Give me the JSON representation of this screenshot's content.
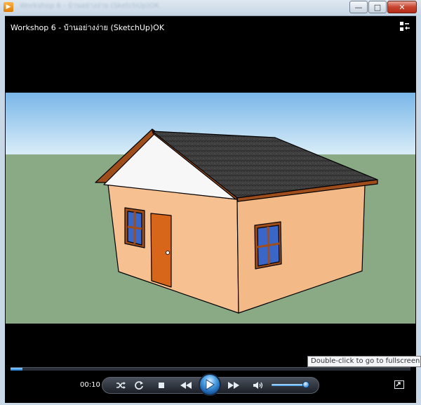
{
  "window": {
    "video_title": "Workshop 6 - บ้านอย่างง่าย (SketchUp)OK",
    "ghost_title": "Workshop 6 - บ้านอย่างง่าย (SketchUp)OK - Windows Media Player",
    "caption": {
      "minimize": "—",
      "maximize": "□",
      "close": "✕"
    }
  },
  "player": {
    "elapsed_time": "00:10",
    "seek_progress": 0.03,
    "volume_level": 0.9,
    "tooltip": "Double-click to go to fullscreen, ctrl+"
  },
  "icons": {
    "app": "media-player-icon",
    "layout": "switch-to-library-icon",
    "shuffle": "shuffle-icon",
    "repeat": "repeat-icon",
    "stop": "stop-icon",
    "previous": "previous-icon",
    "play": "play-icon",
    "next": "next-icon",
    "volume": "speaker-icon",
    "fullscreen": "fullscreen-icon"
  },
  "colors": {
    "sky_top": "#79b6e8",
    "sky_bottom": "#d9edf8",
    "ground": "#8aaa86",
    "wall_front": "#f6c090",
    "wall_side": "#f3ba87",
    "roof": "#3e3e3e",
    "gable": "#f7f7f7",
    "trim": "#a04d1c",
    "door": "#d7651a",
    "glass": "#3a66c8"
  }
}
